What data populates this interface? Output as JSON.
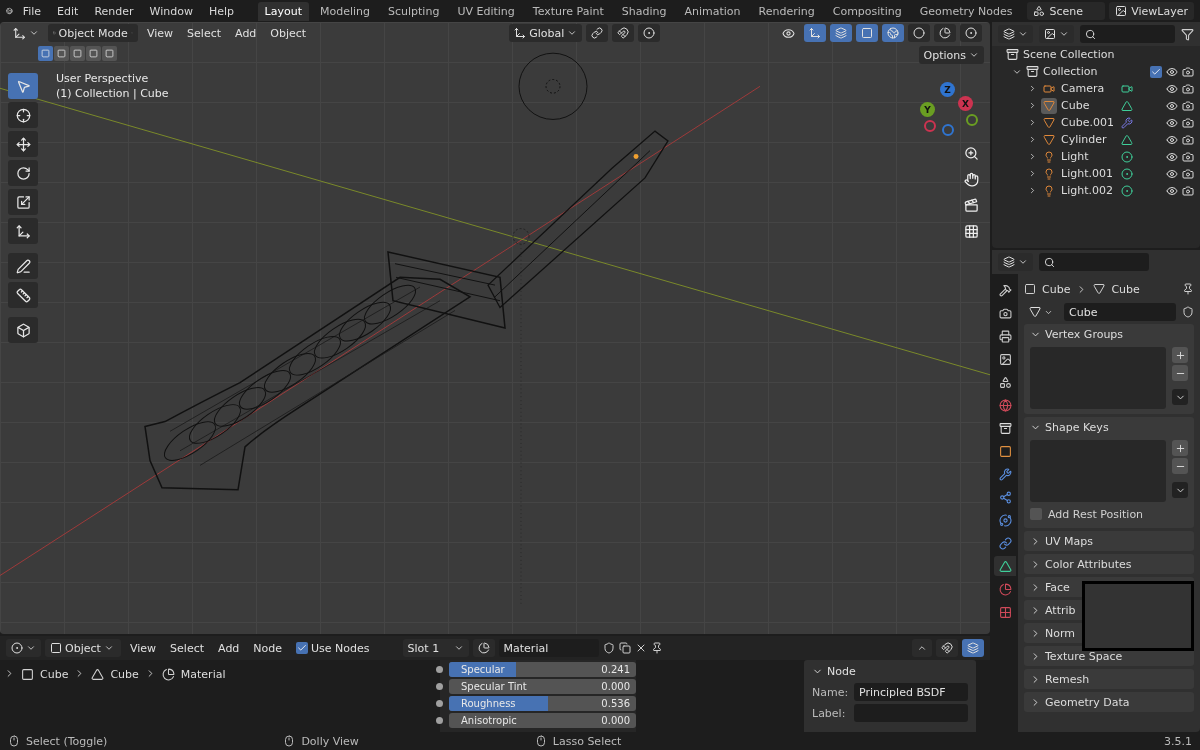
{
  "top_bar": {
    "menus": [
      "File",
      "Edit",
      "Render",
      "Window",
      "Help"
    ],
    "workspaces": [
      {
        "label": "Layout",
        "selected": true
      },
      {
        "label": "Modeling",
        "selected": false
      },
      {
        "label": "Sculpting",
        "selected": false
      },
      {
        "label": "UV Editing",
        "selected": false
      },
      {
        "label": "Texture Paint",
        "selected": false
      },
      {
        "label": "Shading",
        "selected": false
      },
      {
        "label": "Animation",
        "selected": false
      },
      {
        "label": "Rendering",
        "selected": false
      },
      {
        "label": "Compositing",
        "selected": false
      },
      {
        "label": "Geometry Nodes",
        "selected": false
      }
    ],
    "scene": "Scene",
    "view_layer": "ViewLayer"
  },
  "viewport": {
    "mode": "Object Mode",
    "menus": [
      "View",
      "Select",
      "Add",
      "Object"
    ],
    "orientation": "Global",
    "options": "Options",
    "select_modes": [
      {
        "selected": true
      },
      {
        "selected": false
      },
      {
        "selected": false
      },
      {
        "selected": false
      },
      {
        "selected": false
      }
    ],
    "overlay_text": [
      "User Perspective",
      "(1) Collection | Cube"
    ],
    "tools": [
      {
        "kind": "select",
        "selected": true
      },
      {
        "kind": "cursor",
        "selected": false
      },
      {
        "kind": "move",
        "selected": false
      },
      {
        "kind": "rotate",
        "selected": false
      },
      {
        "kind": "scale",
        "selected": false
      },
      {
        "kind": "transform",
        "selected": false
      },
      {
        "kind": "annotate",
        "selected": false
      },
      {
        "kind": "measure",
        "selected": false
      },
      {
        "kind": "add-cube",
        "selected": false
      }
    ],
    "shading": [
      {
        "kind": "wireframe",
        "selected": true
      },
      {
        "kind": "solid",
        "selected": false
      },
      {
        "kind": "material",
        "selected": false
      },
      {
        "kind": "rendered",
        "selected": false
      }
    ],
    "gizmo": [
      {
        "label": "Z",
        "color": "#2f74d0"
      },
      {
        "label": "Y",
        "color": "#6a9e22"
      },
      {
        "label": "X",
        "color": "#cc3350"
      }
    ]
  },
  "outliner": {
    "root": "Scene Collection",
    "collection": {
      "name": "Collection",
      "checked": true,
      "expanded": true,
      "children": [
        {
          "name": "Camera",
          "kind": "camera",
          "data": {
            "kind": "camera"
          },
          "selected": false
        },
        {
          "name": "Cube",
          "kind": "mesh",
          "data": {
            "kind": "mesh"
          },
          "selected": true
        },
        {
          "name": "Cube.001",
          "kind": "mesh",
          "data": {
            "kind": "modifier"
          },
          "selected": false
        },
        {
          "name": "Cylinder",
          "kind": "mesh",
          "data": {
            "kind": "mesh"
          },
          "selected": false
        },
        {
          "name": "Light",
          "kind": "light",
          "data": {
            "kind": "light"
          },
          "selected": false
        },
        {
          "name": "Light.001",
          "kind": "light",
          "data": {
            "kind": "light"
          },
          "selected": false
        },
        {
          "name": "Light.002",
          "kind": "light",
          "data": {
            "kind": "light"
          },
          "selected": false
        }
      ]
    }
  },
  "properties": {
    "tabs": [
      {
        "kind": "tool",
        "selected": false
      },
      {
        "kind": "render",
        "selected": false
      },
      {
        "kind": "output",
        "selected": false
      },
      {
        "kind": "view-layer",
        "selected": false
      },
      {
        "kind": "scene",
        "selected": false
      },
      {
        "kind": "world",
        "selected": false
      },
      {
        "kind": "collection",
        "selected": false
      },
      {
        "kind": "object",
        "selected": false
      },
      {
        "kind": "modifiers",
        "selected": false
      },
      {
        "kind": "particles",
        "selected": false
      },
      {
        "kind": "physics",
        "selected": false
      },
      {
        "kind": "constraints",
        "selected": false
      },
      {
        "kind": "data",
        "selected": true
      },
      {
        "kind": "material",
        "selected": false
      },
      {
        "kind": "texture",
        "selected": false
      }
    ],
    "breadcrumb": [
      "Cube",
      "Cube"
    ],
    "data_name": "Cube",
    "panels": [
      {
        "title": "Vertex Groups",
        "expanded": true
      },
      {
        "title": "Shape Keys",
        "expanded": true,
        "checkbox": {
          "label": "Add Rest Position",
          "checked": false
        }
      },
      {
        "title": "UV Maps",
        "expanded": false
      },
      {
        "title": "Color Attributes",
        "expanded": false
      },
      {
        "title": "Face",
        "expanded": false
      },
      {
        "title": "Attrib",
        "expanded": false
      },
      {
        "title": "Norm",
        "expanded": false
      },
      {
        "title": "Texture Space",
        "expanded": false
      },
      {
        "title": "Remesh",
        "expanded": false
      },
      {
        "title": "Geometry Data",
        "expanded": false
      }
    ]
  },
  "node_editor": {
    "type": "Object",
    "menus": [
      "View",
      "Select",
      "Add",
      "Node"
    ],
    "use_nodes": {
      "label": "Use Nodes",
      "checked": true
    },
    "slot": "Slot 1",
    "material": "Material",
    "breadcrumb": [
      {
        "kind": "object",
        "label": "Cube"
      },
      {
        "kind": "mesh",
        "label": "Cube"
      },
      {
        "kind": "material",
        "label": "Material"
      }
    ],
    "inputs": [
      {
        "name": "Specular",
        "value": "0.241",
        "level": 0.36
      },
      {
        "name": "Specular Tint",
        "value": "0.000",
        "level": 0
      },
      {
        "name": "Roughness",
        "value": "0.536",
        "level": 0.53
      },
      {
        "name": "Anisotropic",
        "value": "0.000",
        "level": 0
      }
    ],
    "node_panel": {
      "title": "Node",
      "name_label": "Name:",
      "name": "Principled BSDF",
      "label_label": "Label:"
    }
  },
  "status_bar": {
    "hints": [
      "Select (Toggle)",
      "Dolly View",
      "Lasso Select"
    ],
    "version": "3.5.1"
  }
}
